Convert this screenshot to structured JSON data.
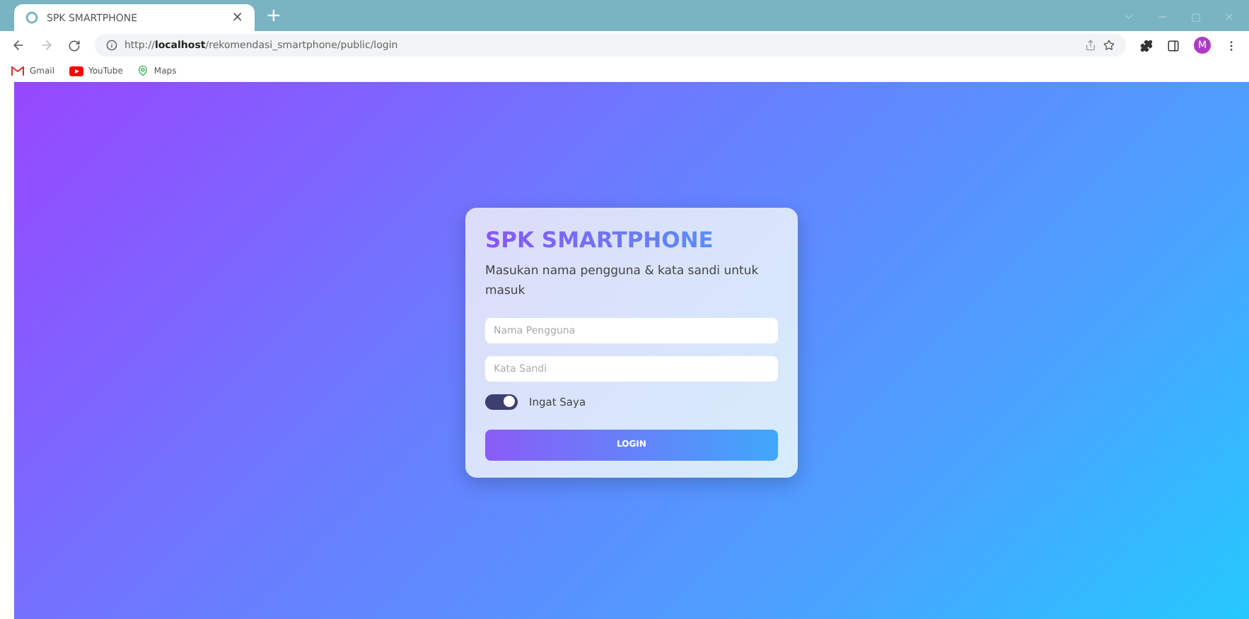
{
  "browser": {
    "tab": {
      "title": "SPK SMARTPHONE",
      "close": "×"
    },
    "new_tab": "+",
    "url": "http://**localhost**/rekomendasi_smartphone/public/login",
    "profile": "M",
    "bookmarks": [
      {
        "label": "Gmail",
        "kind": "gmail"
      },
      {
        "label": "YouTube",
        "kind": "youtube"
      },
      {
        "label": "Maps",
        "kind": "maps"
      }
    ]
  },
  "login": {
    "title": "SPK SMARTPHONE",
    "subtitle": "Masukan nama pengguna & kata sandi untuk masuk",
    "fields": [
      {
        "placeholder": "Nama Pengguna"
      },
      {
        "placeholder": "Kata Sandi"
      }
    ],
    "remember": {
      "label": "Ingat Saya",
      "on": true
    },
    "button": "LOGIN"
  }
}
